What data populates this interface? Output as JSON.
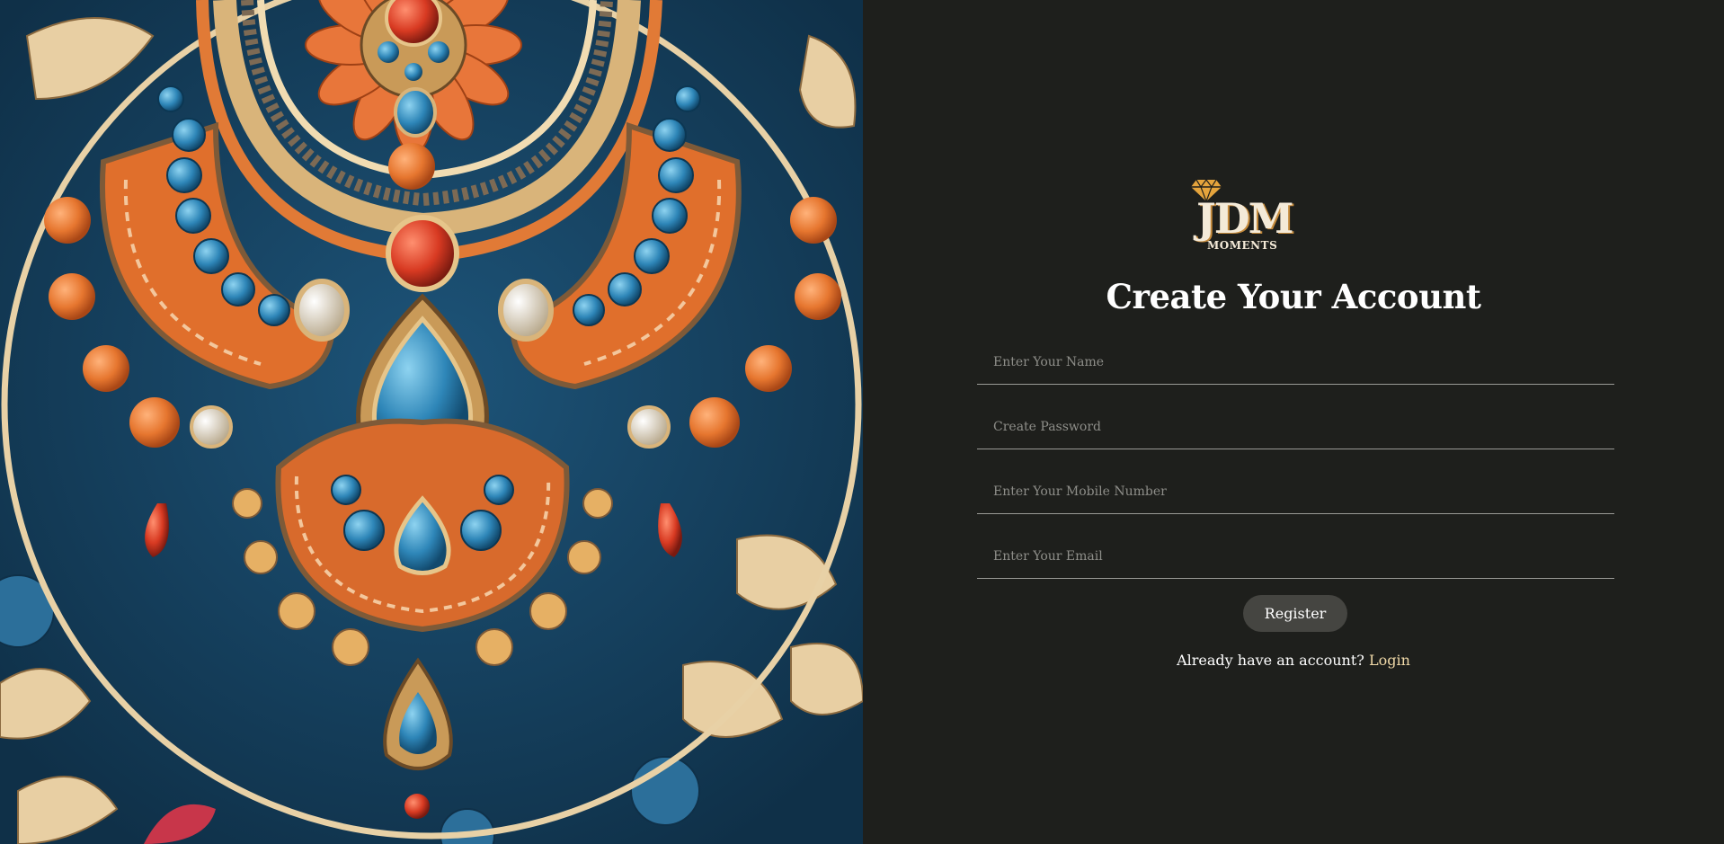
{
  "artwork": {
    "image_name": "ornate-necklace-illustration"
  },
  "brand": {
    "logo_text": "JDM",
    "logo_subtext": "MOMENTS",
    "accent_color": "#e5a43c"
  },
  "form": {
    "title": "Create Your Account",
    "name_placeholder": "Enter Your Name",
    "password_placeholder": "Create Password",
    "mobile_placeholder": "Enter Your Mobile Number",
    "email_placeholder": "Enter Your Email",
    "register_label": "Register",
    "login_prompt": "Already have an account?",
    "login_link": "Login"
  },
  "colors": {
    "panel_background": "#1e1f1c",
    "button_background": "#454541",
    "link_color": "#f0d9a8",
    "art_background": "#163f5c"
  }
}
